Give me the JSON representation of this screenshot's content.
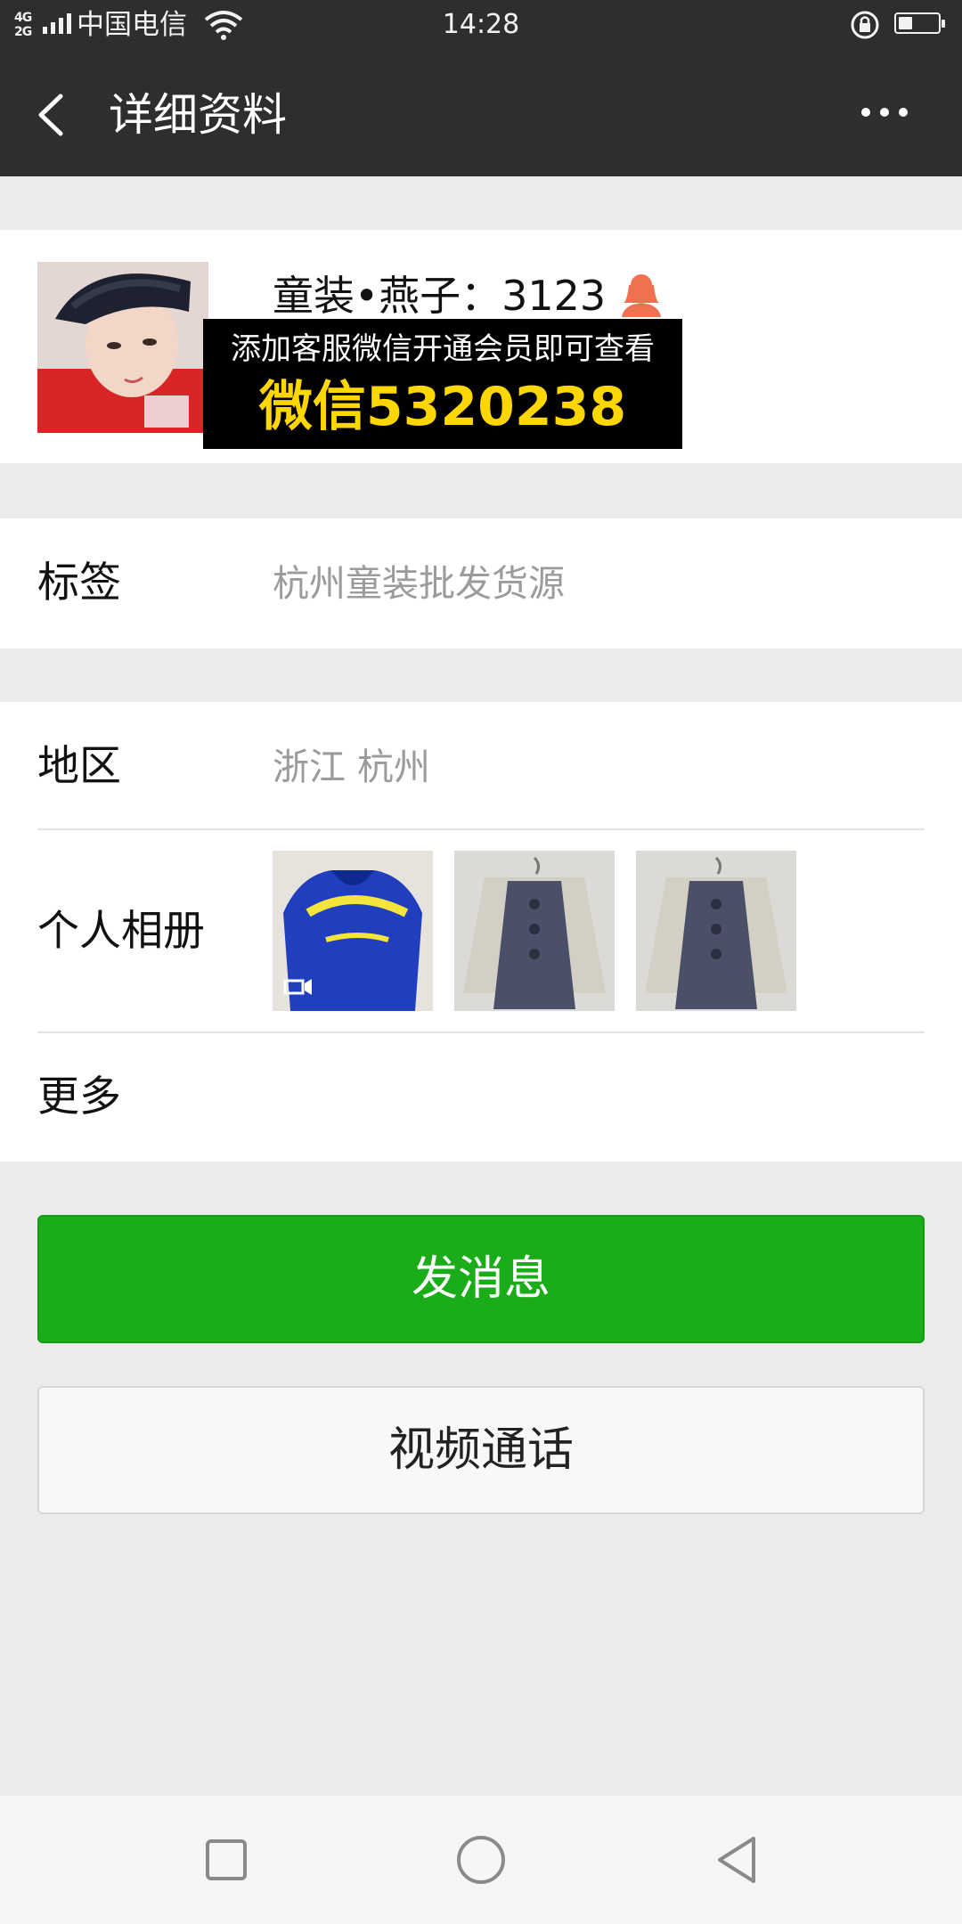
{
  "status_bar": {
    "network": "4G 2G",
    "carrier": "中国电信",
    "time": "14:28",
    "battery_level": 0.35,
    "icons": [
      "signal-icon",
      "wifi-icon",
      "rotation-lock-icon",
      "battery-icon"
    ]
  },
  "header": {
    "title": "详细资料",
    "back_icon": "chevron-left-icon",
    "more_icon": "more-dots-icon"
  },
  "profile": {
    "name": "童装•燕子：3123",
    "gender_icon": "female-user-icon",
    "overlay": {
      "line1": "添加客服微信开通会员即可查看",
      "line2": "微信5320238"
    }
  },
  "rows": {
    "tag": {
      "label": "标签",
      "value": "杭州童装批发货源"
    },
    "region": {
      "label": "地区",
      "value": "浙江  杭州"
    },
    "album": {
      "label": "个人相册",
      "photos": [
        "blue-hoodie-photo",
        "floral-dress-photo",
        "floral-dress-photo"
      ]
    },
    "more": {
      "label": "更多"
    }
  },
  "actions": {
    "send_message": "发消息",
    "video_call": "视频通话"
  },
  "colors": {
    "header_bg": "#2e2e2e",
    "page_bg": "#ebebeb",
    "primary_green": "#1aad19",
    "overlay_yellow": "#ffd700",
    "secondary_text": "#9b9b9b"
  },
  "nav_bar": {
    "icons": [
      "recent-apps-icon",
      "home-icon",
      "back-triangle-icon"
    ]
  }
}
